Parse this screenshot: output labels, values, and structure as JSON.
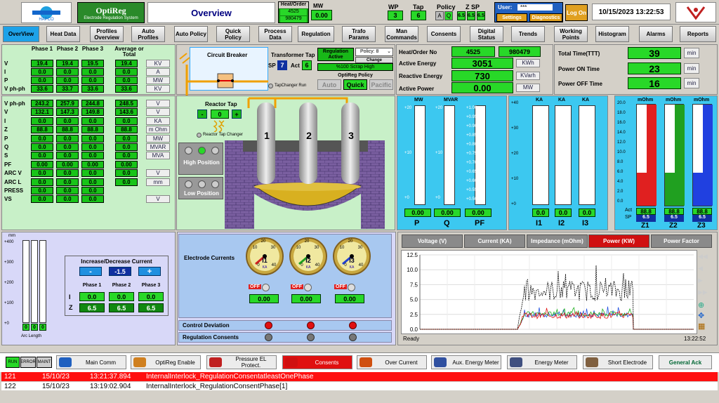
{
  "app": {
    "name": "OptiReg",
    "subtitle": "Electrode Regulation System",
    "logo_text": "HAPCO",
    "page_title": "Overview",
    "date_time": "10/15/2023 13:22:53"
  },
  "header": {
    "heat_order_label": "Heat/Order",
    "heat_order_a": "4525",
    "heat_order_b": "980479",
    "mw_label": "MW",
    "mw_value": "0.00",
    "wp_label": "WP",
    "wp_value": "3",
    "tap_label": "Tap",
    "tap_value": "6",
    "policy_label": "Policy",
    "policy_a": "A",
    "policy_q": "Q",
    "zsp_label": "Z SP",
    "zsp_1": "6.5",
    "zsp_2": "6.5",
    "zsp_3": "6.5",
    "user_label": "User:",
    "user_value": "***",
    "settings": "Settings",
    "diagnostics": "Diagnostics",
    "logon": "Log On"
  },
  "nav": [
    {
      "label": "OverView"
    },
    {
      "label": "Heat Data"
    },
    {
      "label": "Profiles Overview"
    },
    {
      "label": "Auto Profiles"
    },
    {
      "label": "Auto Policy"
    },
    {
      "label": "Quick Policy"
    },
    {
      "label": "Process Data"
    },
    {
      "label": "Regulation"
    },
    {
      "label": "Trafo Params"
    },
    {
      "label": "Man Commands"
    },
    {
      "label": "Consents"
    },
    {
      "label": "Digital Status"
    },
    {
      "label": "Trends"
    },
    {
      "label": "Working Points"
    },
    {
      "label": "Histogram"
    },
    {
      "label": "Alarms"
    },
    {
      "label": "Reports"
    }
  ],
  "phase_table": {
    "headers": [
      "Phase 1",
      "Phase 2",
      "Phase 3",
      "Average or Total"
    ],
    "rows": [
      {
        "label": "V",
        "vals": [
          "19.4",
          "19.4",
          "19.5",
          "19.4"
        ],
        "unit": "KV"
      },
      {
        "label": "I",
        "vals": [
          "0.0",
          "0.0",
          "0.0",
          "0.0"
        ],
        "unit": "A"
      },
      {
        "label": "P",
        "vals": [
          "0.0",
          "0.0",
          "0.0",
          "0.0"
        ],
        "unit": "MW"
      },
      {
        "label": "V ph-ph",
        "vals": [
          "33.6",
          "33.7",
          "33.6",
          "33.6"
        ],
        "unit": "KV"
      }
    ],
    "rows2": [
      {
        "label": "V ph-ph",
        "vals": [
          "243.2",
          "257.9",
          "244.8",
          "248.5"
        ],
        "unit": "V"
      },
      {
        "label": "V",
        "vals": [
          "132.1",
          "147.3",
          "149.8",
          "143.6"
        ],
        "unit": "V"
      },
      {
        "label": "I",
        "vals": [
          "0.0",
          "0.0",
          "0.0",
          "0.0"
        ],
        "unit": "KA"
      },
      {
        "label": "Z",
        "vals": [
          "88.8",
          "88.8",
          "88.8",
          "88.8"
        ],
        "unit": "m Ohm"
      },
      {
        "label": "P",
        "vals": [
          "0.0",
          "0.0",
          "0.0",
          "0.0"
        ],
        "unit": "MW"
      },
      {
        "label": "Q",
        "vals": [
          "0.0",
          "0.0",
          "0.0",
          "0.0"
        ],
        "unit": "MVAR"
      },
      {
        "label": "S",
        "vals": [
          "0.0",
          "0.0",
          "0.0",
          "0.0"
        ],
        "unit": "MVA"
      },
      {
        "label": "PF",
        "vals": [
          "0.00",
          "0.00",
          "0.00",
          "0.00"
        ],
        "unit": ""
      },
      {
        "label": "ARC V",
        "vals": [
          "0.0",
          "0.0",
          "0.0",
          "0.0"
        ],
        "unit": "V"
      },
      {
        "label": "ARC L",
        "vals": [
          "0.0",
          "0.0",
          "0.0",
          "0.0"
        ],
        "unit": "mm"
      },
      {
        "label": "PRESS",
        "vals": [
          "0.0",
          "0.0",
          "0.0",
          ""
        ],
        "unit": ""
      },
      {
        "label": "VS",
        "vals": [
          "0.0",
          "0.0",
          "0.0",
          ""
        ],
        "unit": "V"
      }
    ]
  },
  "breaker": {
    "title": "Circuit Breaker",
    "transformer_tap": "Transformer Tap",
    "sp_label": "SP",
    "sp_value": "7",
    "act_label": "Act",
    "act_value": "6",
    "tapchanger_run": "TapChanger Run",
    "reg_active": "Regulation Active",
    "policy_sel": "Policy: 8",
    "change": "Change",
    "scrap": "%100 Scrap High",
    "optireg_policy": "OptiReg Policy",
    "auto": "Auto",
    "quick": "Quick",
    "pacific": "Pacific"
  },
  "reactor": {
    "title": "Reactor Tap",
    "minus": "-",
    "value": "0",
    "plus": "+",
    "changer": "Reactor Tap Changer",
    "high": "High Position",
    "low": "Low Position",
    "e1": "1",
    "e2": "2",
    "e3": "3"
  },
  "energy": {
    "heat_order_label": "Heat/Order No",
    "heat_a": "4525",
    "heat_b": "980479",
    "active_energy_label": "Active Energy",
    "active_energy": "3051",
    "active_energy_unit": "KWh",
    "reactive_energy_label": "Reactive Energy",
    "reactive_energy": "730",
    "reactive_energy_unit": "KVarh",
    "active_power_label": "Active Power",
    "active_power": "0.00",
    "active_power_unit": "MW"
  },
  "times": {
    "ttt_label": "Total Time(TTT)",
    "ttt": "39",
    "on_label": "Power ON Time",
    "on": "23",
    "off_label": "Power OFF Time",
    "off": "16",
    "unit": "min"
  },
  "bars_mw": {
    "labels": [
      "MW",
      "MVAR",
      ""
    ],
    "scale_mw": [
      "+20",
      "+10",
      "+0"
    ],
    "scale_pf": [
      "+1.00",
      "+0.95",
      "+0.90",
      "+0.85",
      "+0.80",
      "+0.75",
      "+0.70",
      "+0.65",
      "+0.60",
      "+0.55",
      "+0.50"
    ],
    "vals": [
      "0.00",
      "0.00",
      "0.00"
    ],
    "names": [
      "P",
      "Q",
      "PF"
    ],
    "levels": [
      0,
      0,
      0
    ]
  },
  "bars_ka": {
    "labels": [
      "KA",
      "KA",
      "KA"
    ],
    "scale": [
      "+40",
      "+30",
      "+20",
      "+10",
      "+0"
    ],
    "vals": [
      "0.0",
      "0.0",
      "0.0"
    ],
    "names": [
      "I1",
      "I2",
      "I3"
    ],
    "levels": [
      0,
      0,
      0
    ]
  },
  "bars_z": {
    "labels": [
      "mOhm",
      "mOhm",
      "mOhm"
    ],
    "scale": [
      "20.0",
      "18.0",
      "16.0",
      "14.0",
      "12.0",
      "10.0",
      "8.0",
      "6.0",
      "4.0",
      "2.0",
      "0.0"
    ],
    "act_label": "Act",
    "sp_label": "SP",
    "act": [
      "88.8",
      "88.8",
      "88.8"
    ],
    "sp": [
      "6.5",
      "6.5",
      "6.5"
    ],
    "names": [
      "Z1",
      "Z2",
      "Z3"
    ],
    "sp_levels": [
      0.325,
      0.325,
      0.325
    ]
  },
  "arc": {
    "scale_label": "mm",
    "scale": [
      "+400",
      "+300",
      "+200",
      "+100",
      "+0"
    ],
    "vals": [
      "0",
      "0",
      "0"
    ],
    "footer": "Arc Length",
    "panel_title": "Increase/Decrease Current",
    "minus": "-",
    "value": "-1.5",
    "plus": "+",
    "phases": [
      "Phase 1",
      "Phase 2",
      "Phase 3"
    ],
    "i_label": "I",
    "z_label": "Z",
    "i_vals": [
      "0.0",
      "0.0",
      "0.0"
    ],
    "z_vals": [
      "6.5",
      "6.5",
      "6.5"
    ]
  },
  "currents": {
    "title": "Electrode Currents",
    "gauges": [
      "I1",
      "I2",
      "I3"
    ],
    "gauge_unit": "KA",
    "gauge_scale": [
      "0",
      "10",
      "20",
      "30",
      "40"
    ],
    "off": "OFF",
    "vals": [
      "0.00",
      "0.00",
      "0.00"
    ],
    "control_dev": "Control Deviation",
    "reg_consents": "Regulation Consents"
  },
  "trend": {
    "tabs": [
      "Voltage (V)",
      "Current (KA)",
      "Impedance (mOhm)",
      "Power (KW)",
      "Power Factor"
    ],
    "active_tab": 3,
    "yticks": [
      "12.5",
      "10.0",
      "7.5",
      "5.0",
      "2.5",
      "0.0"
    ],
    "status": "Ready",
    "time": "13:22:52"
  },
  "status_bar": {
    "run": "RUN",
    "error": "ERROR",
    "maint": "MAINT",
    "items": [
      "Main Comm",
      "OptiReg Enable",
      "Pressure EL Protect.",
      "Consents",
      "Over Current",
      "Aux. Energy Meter",
      "Energy Meter",
      "Short Electrode"
    ],
    "ack": "General Ack"
  },
  "alarms": [
    {
      "id": "121",
      "date": "15/10/23",
      "time": "13:21:37.894",
      "text": "InternalInterlock_RegulationConsentatleastOnePhase"
    },
    {
      "id": "122",
      "date": "15/10/23",
      "time": "13:19:02.904",
      "text": "InternalInterlock_RegulationConsentPhase[1]"
    }
  ],
  "colors": {
    "green": "#28d828",
    "panel_green": "#c8f0c8",
    "blue_panel": "#3cc8f0",
    "lavender": "#d8d8f8",
    "alarm_red": "#ff1010"
  }
}
